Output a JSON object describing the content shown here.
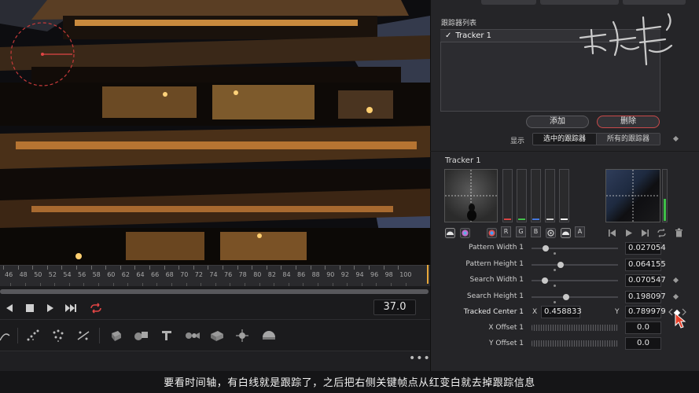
{
  "timeline": {
    "ruler_labels": [
      "46",
      "48",
      "50",
      "52",
      "54",
      "56",
      "58",
      "60",
      "62",
      "64",
      "66",
      "68",
      "70",
      "72",
      "74",
      "76",
      "78",
      "80",
      "82",
      "84",
      "86",
      "88",
      "90",
      "92",
      "94",
      "96",
      "98",
      "100"
    ],
    "current_frame": "37.0"
  },
  "inspector": {
    "tracker_list_label": "跟踪器列表",
    "trackers": [
      {
        "check": "✓",
        "name": "Tracker 1"
      }
    ],
    "add_label": "添加",
    "delete_label": "删除",
    "show_label": "显示",
    "show_selected": "选中的跟踪器",
    "show_all": "所有的跟踪器",
    "tracker_title": "Tracker 1",
    "channel_chips": [
      "R",
      "G",
      "B",
      "A"
    ],
    "params": {
      "pattern_width": {
        "label": "Pattern Width 1",
        "value": "0.027054"
      },
      "pattern_height": {
        "label": "Pattern Height 1",
        "value": "0.064155"
      },
      "search_width": {
        "label": "Search Width 1",
        "value": "0.070547"
      },
      "search_height": {
        "label": "Search Height 1",
        "value": "0.198097"
      },
      "tracked_center": {
        "label": "Tracked Center 1",
        "x_label": "X",
        "x_value": "0.458833",
        "y_label": "Y",
        "y_value": "0.789979"
      },
      "x_offset": {
        "label": "X Offset 1",
        "value": "0.0"
      },
      "y_offset": {
        "label": "Y Offset 1",
        "value": "0.0"
      }
    }
  },
  "subtitle": "要看时间轴，有白线就是跟踪了，之后把右侧关键帧点从红变白就去掉跟踪信息",
  "colors": {
    "accent_orange": "#e8a83a",
    "delete_red": "#c94a4a",
    "loop_red": "#e04545",
    "meter_green": "#3fbf48"
  }
}
